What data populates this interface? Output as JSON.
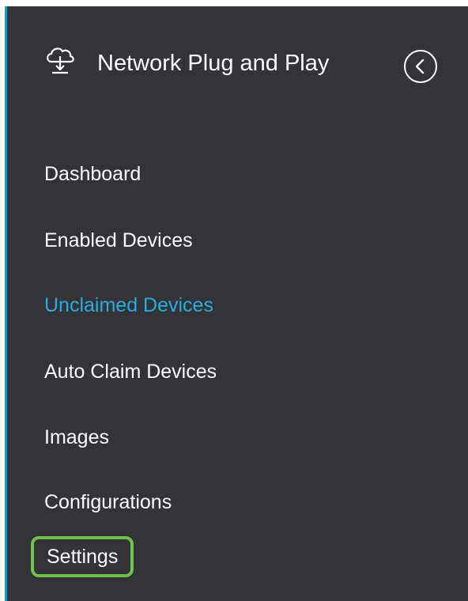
{
  "app": {
    "title": "Network Plug and Play",
    "icon": "cloud-download-icon",
    "collapse_icon": "chevron-left-circle-icon"
  },
  "colors": {
    "sidebar_bg": "#333338",
    "accent": "#00a0d1",
    "active_text": "#22b0e0",
    "highlight_border": "#6cc24a"
  },
  "nav": {
    "items": [
      {
        "label": "Dashboard",
        "active": false
      },
      {
        "label": "Enabled Devices",
        "active": false
      },
      {
        "label": "Unclaimed Devices",
        "active": true
      },
      {
        "label": "Auto Claim Devices",
        "active": false
      },
      {
        "label": "Images",
        "active": false
      },
      {
        "label": "Configurations",
        "active": false
      },
      {
        "label": "Settings",
        "active": false,
        "highlighted": true
      }
    ]
  }
}
